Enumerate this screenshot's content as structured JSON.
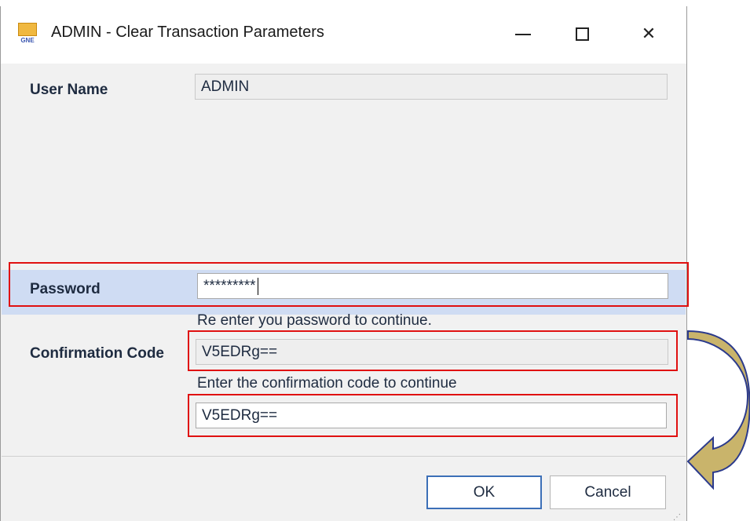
{
  "window": {
    "title": "ADMIN - Clear Transaction Parameters",
    "icon_text": "GNE",
    "controls": {
      "minimize": "minimize-icon",
      "maximize": "maximize-icon",
      "close": "close-icon"
    }
  },
  "form": {
    "user_name": {
      "label": "User Name",
      "value": "ADMIN"
    },
    "password": {
      "label": "Password",
      "value": "*********",
      "hint": "Re enter you password to continue."
    },
    "confirmation_code": {
      "label": "Confirmation Code",
      "value": "V5EDRg==",
      "hint": "Enter the confirmation code to continue"
    },
    "confirmation_input": {
      "value": "V5EDRg=="
    }
  },
  "buttons": {
    "ok": "OK",
    "cancel": "Cancel"
  },
  "colors": {
    "highlight": "#e01010",
    "arrow_fill": "#c9b46b",
    "arrow_stroke": "#2b3a8c",
    "selected_row": "#cfdcf3",
    "ok_border": "#3c6fb7"
  }
}
